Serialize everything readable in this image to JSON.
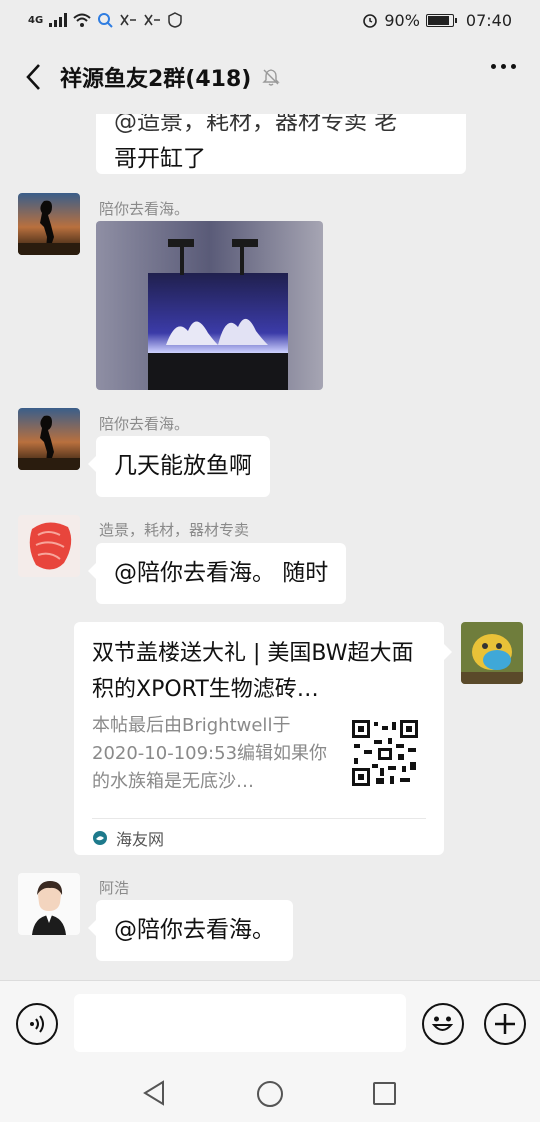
{
  "status_bar": {
    "network": "4G",
    "battery_percent": "90%",
    "battery_level": 0.9,
    "time": "07:40"
  },
  "header": {
    "title": "祥源鱼友2群(418)",
    "back_icon": "back-arrow-icon",
    "mute_icon": "bell-muted-icon",
    "more_icon": "more-dots-icon"
  },
  "messages": [
    {
      "type": "text",
      "partial_text": "@造景，耗材，器材专卖 老",
      "text": "哥开缸了"
    },
    {
      "type": "image",
      "sender": "陪你去看海。"
    },
    {
      "type": "text",
      "sender": "陪你去看海。",
      "text": "几天能放鱼啊"
    },
    {
      "type": "text",
      "sender": "造景，耗材，器材专卖",
      "text": "@陪你去看海。 随时"
    },
    {
      "type": "link_card",
      "title": "双节盖楼送大礼 | 美国BW超大面积的XPORT生物滤砖…",
      "description": "本帖最后由Brightwell于2020-10-109:53编辑如果你的水族箱是无底沙…",
      "source": "海友网"
    },
    {
      "type": "text",
      "sender": "阿浩",
      "text": "@陪你去看海。"
    }
  ],
  "input_bar": {
    "voice_icon": "voice-icon",
    "emoji_icon": "emoji-icon",
    "plus_icon": "plus-icon"
  },
  "nav_bar": {
    "back_icon": "nav-back-icon",
    "home_icon": "nav-home-icon",
    "recent_icon": "nav-recent-icon"
  }
}
